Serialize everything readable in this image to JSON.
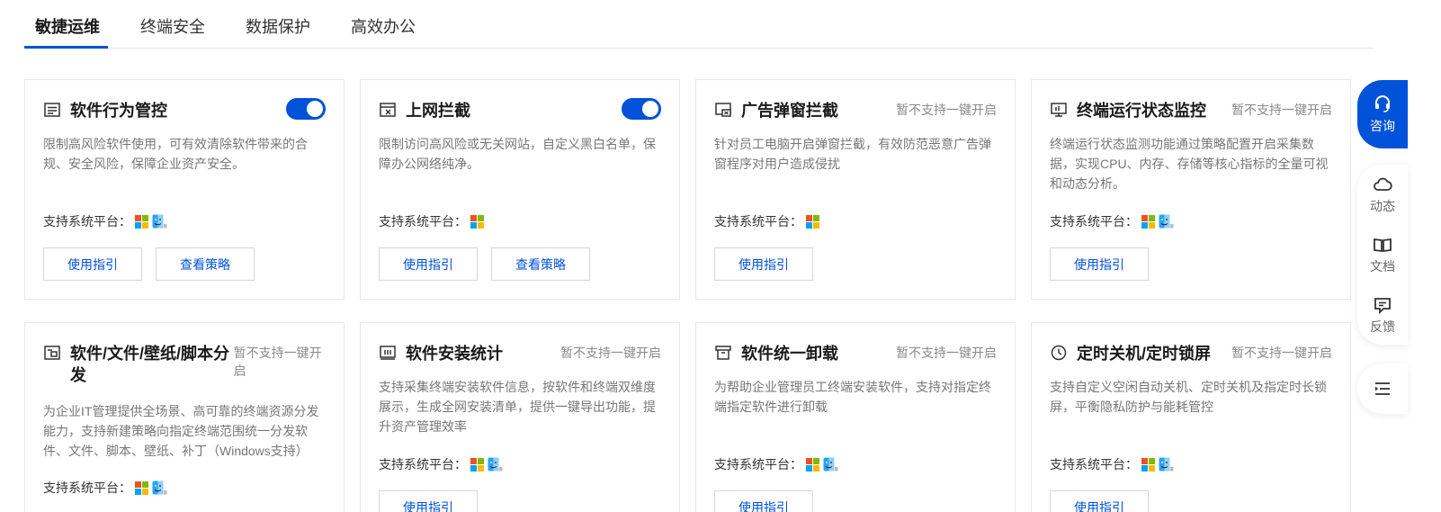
{
  "tabs": [
    {
      "label": "敏捷运维",
      "active": true
    },
    {
      "label": "终端安全",
      "active": false
    },
    {
      "label": "数据保护",
      "active": false
    },
    {
      "label": "高效办公",
      "active": false
    }
  ],
  "platform_label": "支持系统平台：",
  "buttons": {
    "guide": "使用指引",
    "policy": "查看策略"
  },
  "cards": [
    {
      "title": "软件行为管控",
      "desc": "限制高风险软件使用，可有效清除软件带来的合规、安全风险，保障企业资产安全。",
      "status": "",
      "enabled": true,
      "platforms": [
        "windows",
        "mac"
      ]
    },
    {
      "title": "上网拦截",
      "desc": "限制访问高风险或无关网站，自定义黑白名单，保障办公网络纯净。",
      "status": "",
      "enabled": true,
      "platforms": [
        "windows"
      ]
    },
    {
      "title": "广告弹窗拦截",
      "desc": "针对员工电脑开启弹窗拦截，有效防范恶意广告弹窗程序对用户造成侵扰",
      "status": "暂不支持一键开启",
      "enabled": false,
      "platforms": [
        "windows"
      ]
    },
    {
      "title": "终端运行状态监控",
      "desc": "终端运行状态监测功能通过策略配置开启采集数据，实现CPU、内存、存储等核心指标的全量可视和动态分析。",
      "status": "暂不支持一键开启",
      "enabled": false,
      "platforms": [
        "windows",
        "mac"
      ]
    },
    {
      "title": "软件/文件/壁纸/脚本分发",
      "desc": "为企业IT管理提供全场景、高可靠的终端资源分发能力，支持新建策略向指定终端范围统一分发软件、文件、脚本、壁纸、补丁（Windows支持）",
      "status": "暂不支持一键开启",
      "enabled": false,
      "platforms": [
        "windows",
        "mac"
      ]
    },
    {
      "title": "软件安装统计",
      "desc": "支持采集终端安装软件信息，按软件和终端双维度展示，生成全网安装清单，提供一键导出功能，提升资产管理效率",
      "status": "暂不支持一键开启",
      "enabled": false,
      "platforms": [
        "windows",
        "mac"
      ]
    },
    {
      "title": "软件统一卸载",
      "desc": "为帮助企业管理员工终端安装软件，支持对指定终端指定软件进行卸载",
      "status": "暂不支持一键开启",
      "enabled": false,
      "platforms": [
        "windows",
        "mac"
      ]
    },
    {
      "title": "定时关机/定时锁屏",
      "desc": "支持自定义空闲自动关机、定时关机及指定时长锁屏，平衡隐私防护与能耗管控",
      "status": "暂不支持一键开启",
      "enabled": false,
      "platforms": [
        "windows",
        "mac"
      ]
    }
  ],
  "side": {
    "consult": "咨询",
    "news": "动态",
    "docs": "文档",
    "feedback": "反馈"
  },
  "colors": {
    "accent": "#0052d9",
    "muted_text": "#777777",
    "border": "#e8e8e8"
  }
}
